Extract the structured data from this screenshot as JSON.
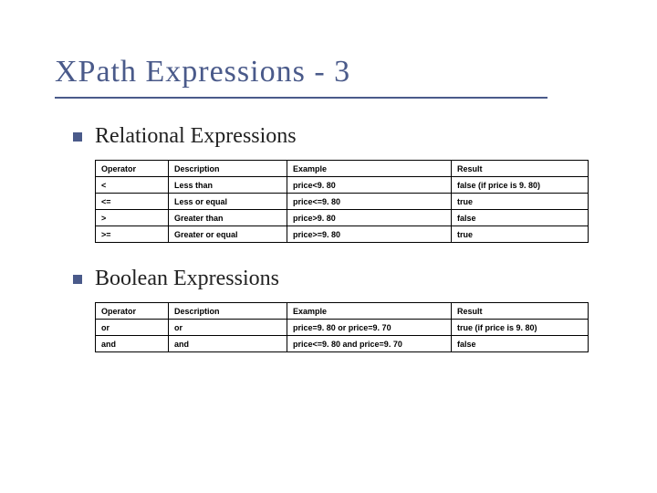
{
  "title": "XPath Expressions - 3",
  "sections": [
    {
      "heading": "Relational Expressions",
      "headers": [
        "Operator",
        "Description",
        "Example",
        "Result"
      ],
      "rows": [
        [
          "<",
          "Less than",
          "price<9. 80",
          "false (if price is 9. 80)"
        ],
        [
          "<=",
          "Less or equal",
          "price<=9. 80",
          "true"
        ],
        [
          ">",
          "Greater than",
          "price>9. 80",
          "false"
        ],
        [
          ">=",
          "Greater or equal",
          "price>=9. 80",
          "true"
        ]
      ]
    },
    {
      "heading": "Boolean Expressions",
      "headers": [
        "Operator",
        "Description",
        "Example",
        "Result"
      ],
      "rows": [
        [
          "or",
          "or",
          "price=9. 80 or price=9. 70",
          "true (if price is 9. 80)"
        ],
        [
          "and",
          "and",
          "price<=9. 80 and price=9. 70",
          "false"
        ]
      ]
    }
  ]
}
